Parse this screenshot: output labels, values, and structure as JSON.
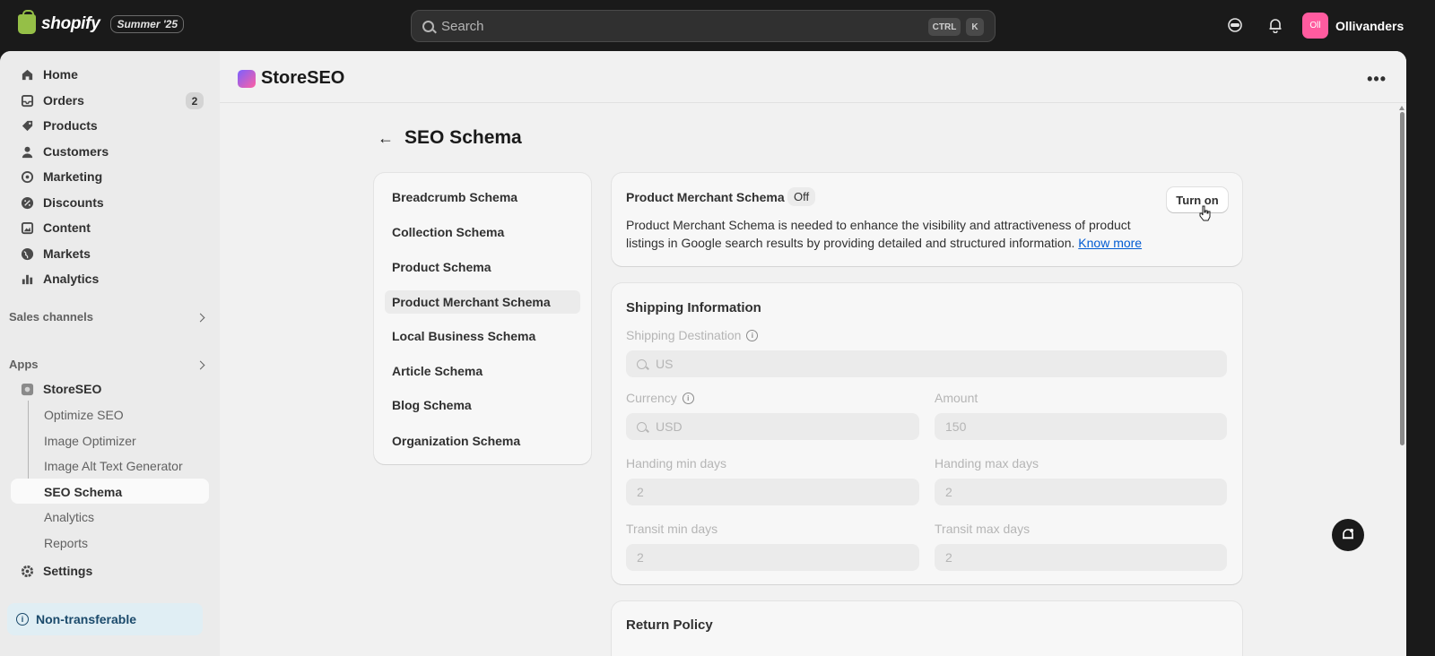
{
  "topbar": {
    "brand": "shopify",
    "edition": "Summer '25",
    "search_placeholder": "Search",
    "shortcut_ctrl": "CTRL",
    "shortcut_k": "K",
    "store_initials": "Oll",
    "store_name": "Ollivanders"
  },
  "sidebar": {
    "items": [
      {
        "label": "Home",
        "icon": "home-icon"
      },
      {
        "label": "Orders",
        "icon": "inbox-icon",
        "badge": "2"
      },
      {
        "label": "Products",
        "icon": "tag-icon"
      },
      {
        "label": "Customers",
        "icon": "person-icon"
      },
      {
        "label": "Marketing",
        "icon": "target-icon"
      },
      {
        "label": "Discounts",
        "icon": "discount-icon"
      },
      {
        "label": "Content",
        "icon": "image-icon"
      },
      {
        "label": "Markets",
        "icon": "globe-icon"
      },
      {
        "label": "Analytics",
        "icon": "bar-chart-icon"
      }
    ],
    "sales_channels": "Sales channels",
    "apps": "Apps",
    "app_name": "StoreSEO",
    "app_sub_items": [
      "Optimize SEO",
      "Image Optimizer",
      "Image Alt Text Generator",
      "SEO Schema",
      "Analytics",
      "Reports"
    ],
    "settings": "Settings",
    "note": "Non-transferable"
  },
  "main": {
    "app_title": "StoreSEO",
    "page_title": "SEO Schema",
    "schema_list": [
      "Breadcrumb Schema",
      "Collection Schema",
      "Product Schema",
      "Product Merchant Schema",
      "Local Business Schema",
      "Article Schema",
      "Blog Schema",
      "Organization Schema"
    ],
    "merchant": {
      "title": "Product Merchant Schema",
      "status": "Off",
      "button": "Turn on",
      "description": "Product Merchant Schema is needed to enhance the visibility and attractiveness of product listings in Google search results by providing detailed and structured information.",
      "link": "Know more"
    },
    "shipping": {
      "title": "Shipping Information",
      "destination_label": "Shipping Destination",
      "destination_value": "US",
      "currency_label": "Currency",
      "currency_value": "USD",
      "amount_label": "Amount",
      "amount_value": "150",
      "handling_min_label": "Handing min days",
      "handling_min_value": "2",
      "handling_max_label": "Handing max days",
      "handling_max_value": "2",
      "transit_min_label": "Transit min days",
      "transit_min_value": "2",
      "transit_max_label": "Transit max days",
      "transit_max_value": "2"
    },
    "return_policy": {
      "title": "Return Policy"
    }
  },
  "colors": {
    "accent_link": "#005bd3",
    "store_avatar": "#ff5b9f",
    "topbar": "#1a1a1a"
  }
}
